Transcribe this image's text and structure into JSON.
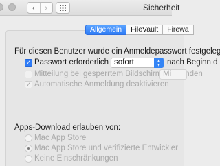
{
  "window": {
    "title": "Sicherheit"
  },
  "toolbar": {
    "back_glyph": "‹",
    "forward_glyph": "›",
    "show_all_icon": "grid-icon"
  },
  "tabs": [
    {
      "label": "Allgemein",
      "active": true
    },
    {
      "label": "FileVault",
      "active": false
    },
    {
      "label": "Firewa",
      "active": false
    }
  ],
  "login_section": {
    "heading": "Für diesen Benutzer wurde ein Anmeldepasswort festgelegt",
    "require_password": {
      "label": "Passwort erforderlich",
      "checked": true,
      "dropdown_value": "sofort",
      "suffix": "nach Beginn d"
    },
    "show_message": {
      "label": "Mitteilung bei gesperrtem Bildschirm einblenden",
      "checked": false,
      "enabled": false,
      "button_label": "Mi"
    },
    "auto_login": {
      "label": "Automatische Anmeldung deaktivieren",
      "checked": true,
      "enabled": false
    }
  },
  "apps_section": {
    "heading": "Apps-Download erlauben von:",
    "options": [
      {
        "label": "Mac App Store",
        "selected": false
      },
      {
        "label": "Mac App Store und verifizierte Entwickler",
        "selected": true
      },
      {
        "label": "Keine Einschränkungen",
        "selected": false
      }
    ]
  },
  "colors": {
    "accent": "#2f7cf7",
    "window_bg": "#ececec",
    "disabled_text": "#a9a9a9"
  }
}
